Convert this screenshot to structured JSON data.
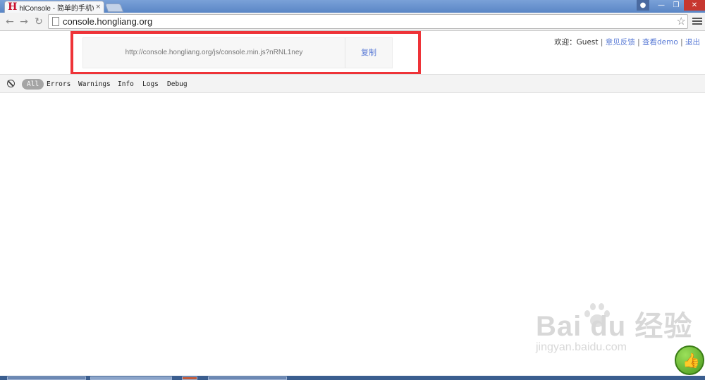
{
  "browser": {
    "tab_title": "hlConsole - 简单的手机Web调试",
    "tab_favicon": "H",
    "tab_close": "×",
    "url": "console.hongliang.org"
  },
  "header": {
    "script_url": "http://console.hongliang.org/js/console.min.js?nRNL1ney",
    "copy_label": "复制",
    "welcome": "欢迎：Guest",
    "sep": "|",
    "feedback": "意见反馈",
    "demo": "查看demo",
    "logout": "退出"
  },
  "console": {
    "filters": [
      "All",
      "Errors",
      "Warnings",
      "Info",
      "Logs",
      "Debug"
    ],
    "active_filter": "All"
  },
  "watermark": {
    "brand": "Bai du 经验",
    "sub": "jingyan.baidu.com"
  },
  "colors": {
    "highlight": "#ee3338",
    "link": "#5a7bd6",
    "titlebar": "#6a92cc"
  }
}
